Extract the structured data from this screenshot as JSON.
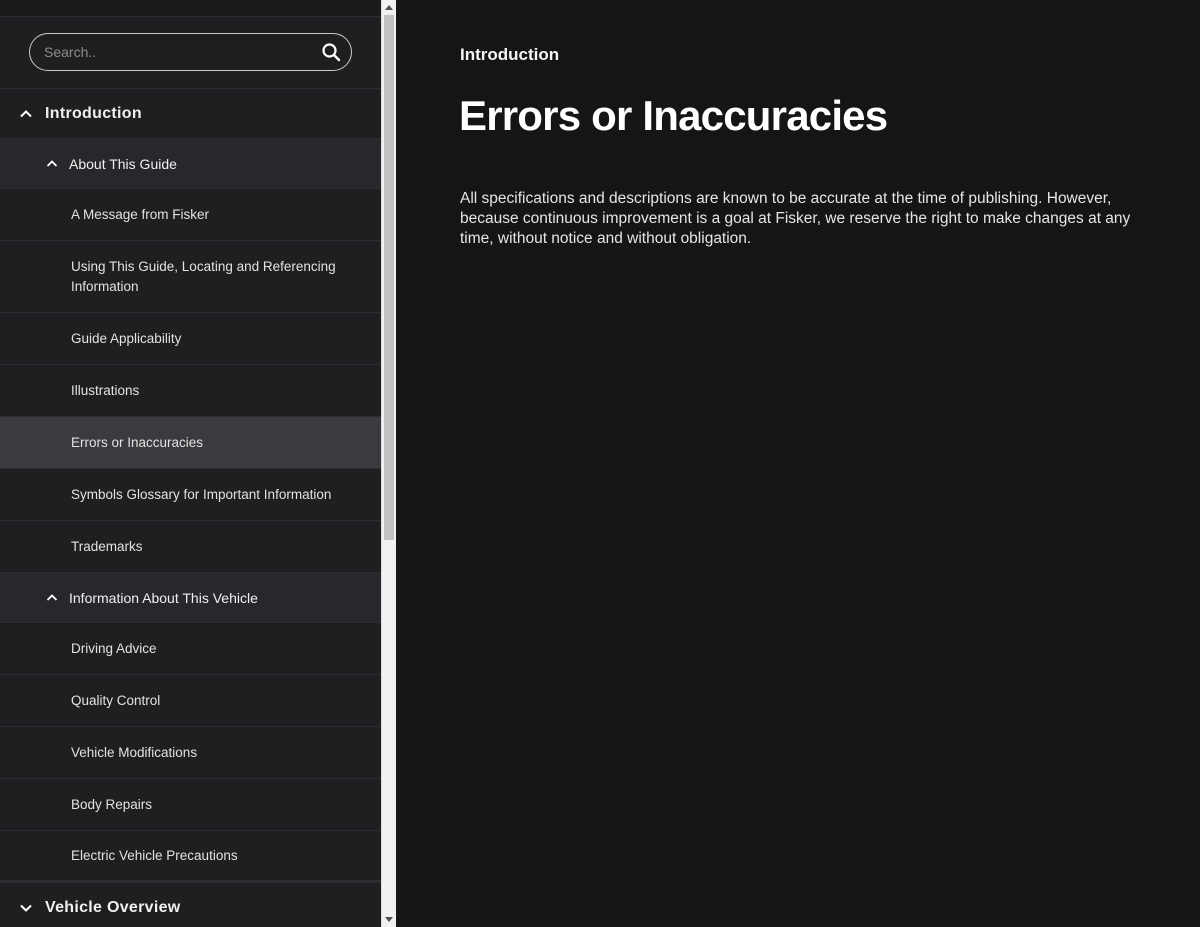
{
  "search": {
    "placeholder": "Search.."
  },
  "sidebar": {
    "sections": [
      {
        "label": "Introduction",
        "expanded": true
      },
      {
        "label": "Vehicle Overview",
        "expanded": false
      }
    ],
    "groups": [
      {
        "label": "About This Guide",
        "items": [
          "A Message from Fisker",
          "Using This Guide, Locating and Referencing Information",
          "Guide Applicability",
          "Illustrations",
          "Errors or Inaccuracies",
          "Symbols Glossary for Important Information",
          "Trademarks"
        ]
      },
      {
        "label": "Information About This Vehicle",
        "items": [
          "Driving Advice",
          "Quality Control",
          "Vehicle Modifications",
          "Body Repairs",
          "Electric Vehicle Precautions"
        ]
      }
    ],
    "active_item": "Errors or Inaccuracies"
  },
  "main": {
    "section": "Introduction",
    "title": "Errors or Inaccuracies",
    "body": "All specifications and descriptions are known to be accurate at the time of publishing. However, because continuous improvement is a goal at Fisker, we reserve the right to make changes at any time, without notice and without obligation."
  },
  "icons": {
    "search": "search-icon",
    "expanded": "chevron-up-icon",
    "collapsed": "chevron-down-icon"
  },
  "colors": {
    "background": "#151517",
    "sidebar": "#1e1f21",
    "group_header": "#27282b",
    "active_item": "#3a3b3e"
  }
}
